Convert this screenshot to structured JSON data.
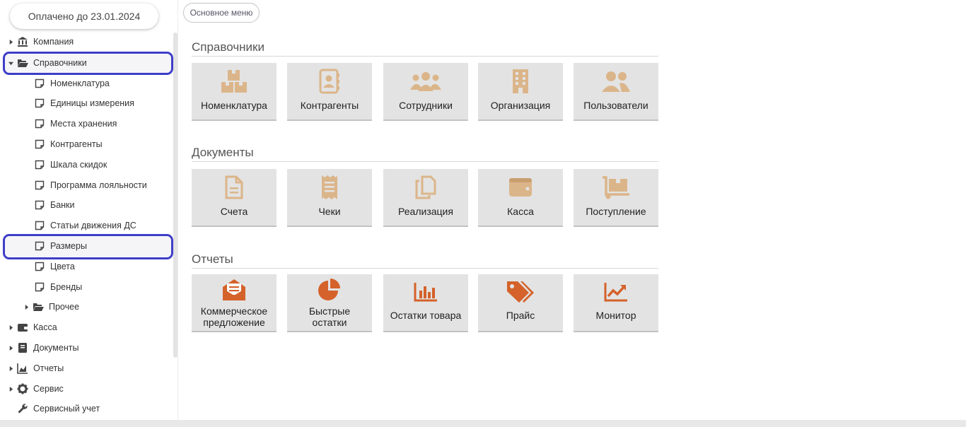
{
  "sidebar": {
    "paid_label": "Оплачено до 23.01.2024",
    "items": [
      {
        "label": "Компания"
      },
      {
        "label": "Справочники"
      },
      {
        "label": "Номенклатура"
      },
      {
        "label": "Единицы измерения"
      },
      {
        "label": "Места хранения"
      },
      {
        "label": "Контрагенты"
      },
      {
        "label": "Шкала скидок"
      },
      {
        "label": "Программа лояльности"
      },
      {
        "label": "Банки"
      },
      {
        "label": "Статьи движения ДС"
      },
      {
        "label": "Размеры"
      },
      {
        "label": "Цвета"
      },
      {
        "label": "Бренды"
      },
      {
        "label": "Прочее"
      },
      {
        "label": "Касса"
      },
      {
        "label": "Документы"
      },
      {
        "label": "Отчеты"
      },
      {
        "label": "Сервис"
      },
      {
        "label": "Сервисный учет"
      }
    ]
  },
  "main": {
    "main_menu_label": "Основное меню",
    "sections": [
      {
        "title": "Справочники",
        "tiles": [
          {
            "label": "Номенклатура",
            "icon": "boxes-icon"
          },
          {
            "label": "Контрагенты",
            "icon": "address-book-icon"
          },
          {
            "label": "Сотрудники",
            "icon": "users-icon"
          },
          {
            "label": "Организация",
            "icon": "building-icon"
          },
          {
            "label": "Пользователи",
            "icon": "user-friends-icon"
          }
        ]
      },
      {
        "title": "Документы",
        "tiles": [
          {
            "label": "Счета",
            "icon": "file-icon"
          },
          {
            "label": "Чеки",
            "icon": "receipt-icon"
          },
          {
            "label": "Реализация",
            "icon": "copy-icon"
          },
          {
            "label": "Касса",
            "icon": "wallet-icon"
          },
          {
            "label": "Поступление",
            "icon": "dolly-icon"
          }
        ]
      },
      {
        "title": "Отчеты",
        "tiles": [
          {
            "label": "Коммерческое предложение",
            "icon": "envelope-open-icon"
          },
          {
            "label": "Быстрые остатки",
            "icon": "pie-chart-icon"
          },
          {
            "label": "Остатки товара",
            "icon": "bar-chart-icon"
          },
          {
            "label": "Прайс",
            "icon": "tags-icon"
          },
          {
            "label": "Монитор",
            "icon": "line-chart-icon"
          }
        ]
      }
    ]
  },
  "colors": {
    "icon_tan": "#dbb58a",
    "icon_orange": "#d4622a",
    "highlight": "#3e3ec8",
    "tile_bg": "#e3e3e3"
  }
}
